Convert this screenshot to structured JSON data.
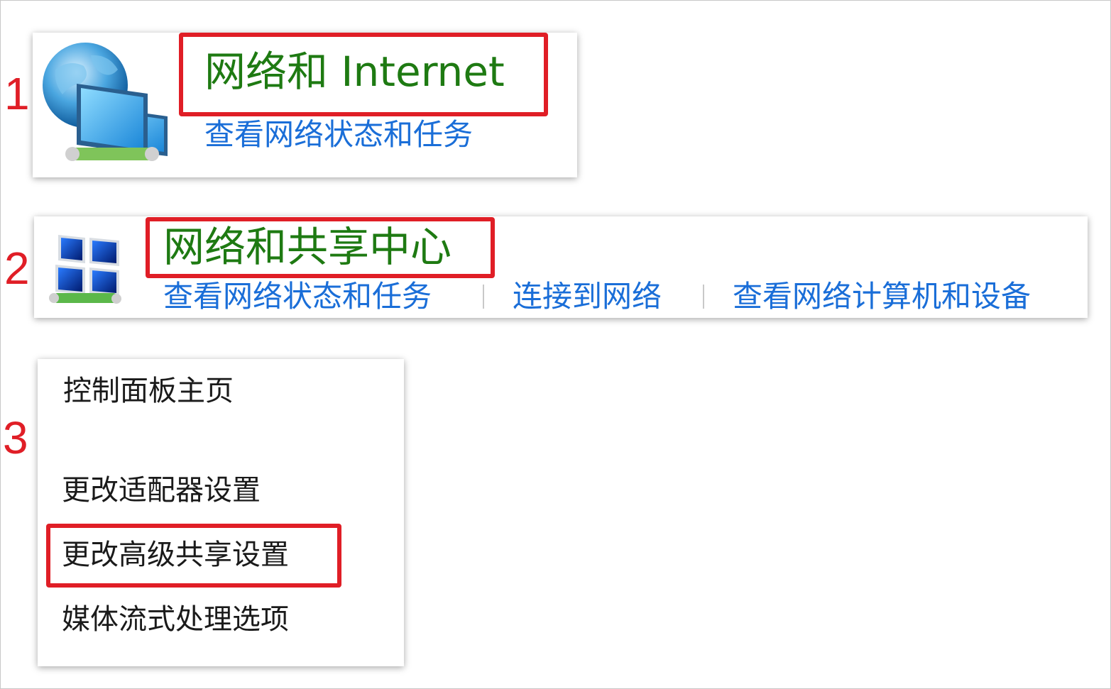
{
  "steps": {
    "one": "1",
    "two": "2",
    "three": "3"
  },
  "network_internet": {
    "title": "网络和 Internet",
    "link": "查看网络状态和任务",
    "icon": "network-globe-icon"
  },
  "sharing_center": {
    "title": "网络和共享中心",
    "links": [
      "查看网络状态和任务",
      "连接到网络",
      "查看网络计算机和设备"
    ],
    "icon": "network-sharing-icon"
  },
  "sidebar": {
    "items": [
      "控制面板主页",
      "更改适配器设置",
      "更改高级共享设置",
      "媒体流式处理选项"
    ]
  },
  "colors": {
    "title_green": "#1e7a12",
    "link_blue": "#1a6ed8",
    "highlight_red": "#e01e26"
  }
}
